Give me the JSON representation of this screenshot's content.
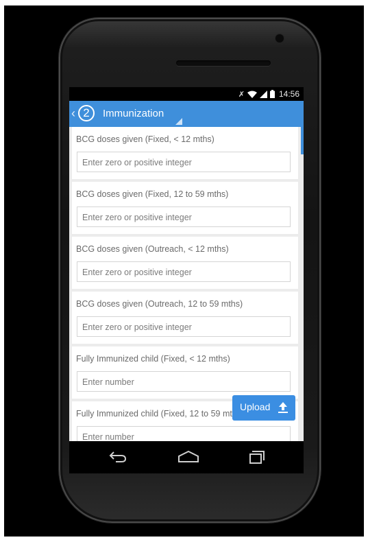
{
  "status_bar": {
    "time": "14:56",
    "icons": [
      "mute-icon",
      "wifi-icon",
      "signal-icon",
      "battery-icon"
    ]
  },
  "app_bar": {
    "back_glyph": "‹",
    "step_number": "2",
    "title": "Immunization",
    "color": "#3f8fdb"
  },
  "form": {
    "fields": [
      {
        "label": "BCG doses given (Fixed, < 12 mths)",
        "placeholder": "Enter zero or positive integer"
      },
      {
        "label": "BCG doses given (Fixed, 12 to 59 mths)",
        "placeholder": "Enter zero or positive integer"
      },
      {
        "label": "BCG doses given (Outreach, < 12 mths)",
        "placeholder": "Enter zero or positive integer"
      },
      {
        "label": "BCG doses given (Outreach, 12 to 59 mths)",
        "placeholder": "Enter zero or positive integer"
      },
      {
        "label": "Fully Immunized child (Fixed, < 12 mths)",
        "placeholder": "Enter number"
      },
      {
        "label": "Fully Immunized child (Fixed, 12 to 59 mths)",
        "placeholder": "Enter number"
      }
    ]
  },
  "upload_button": {
    "label": "Upload",
    "icon": "upload-icon",
    "color": "#3b8ee2"
  },
  "nav_bar": {
    "icons": [
      "back-nav-icon",
      "home-nav-icon",
      "recent-apps-icon"
    ]
  }
}
